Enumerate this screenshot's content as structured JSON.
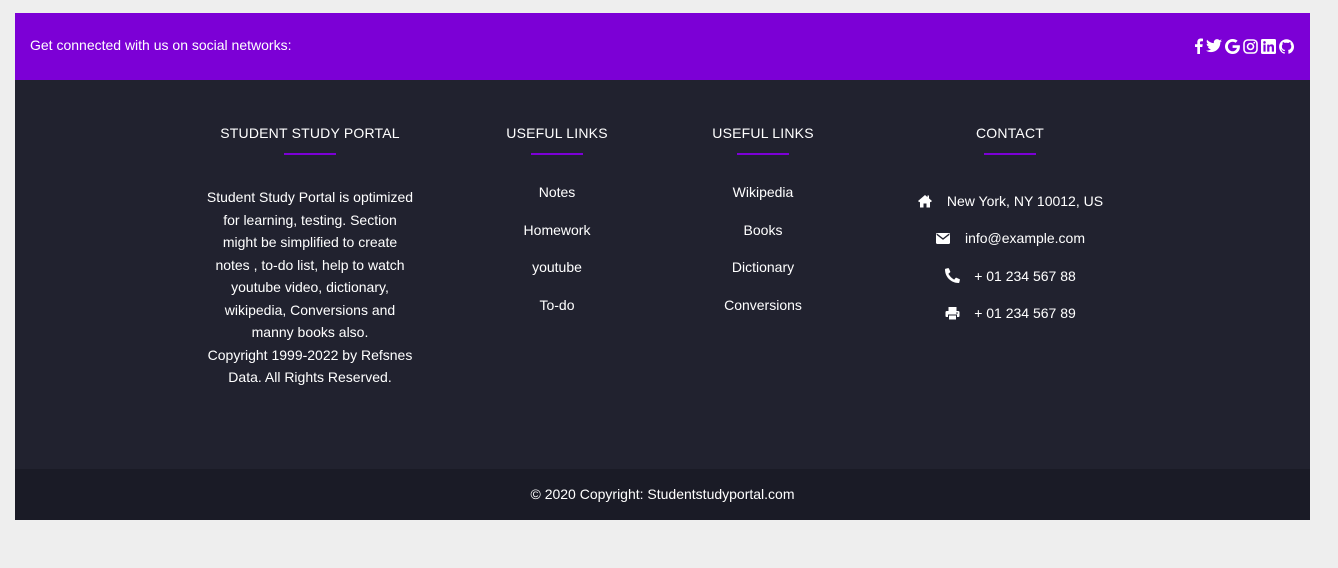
{
  "social": {
    "text": "Get connected with us on social networks:",
    "icons": [
      "facebook-icon",
      "twitter-icon",
      "google-icon",
      "instagram-icon",
      "linkedin-icon",
      "github-icon"
    ]
  },
  "columns": {
    "about": {
      "title": "STUDENT STUDY PORTAL",
      "lines": [
        "Student Study Portal is optimized",
        "for learning, testing. Section",
        "might be simplified to create",
        "notes , to-do list, help to watch",
        "youtube video, dictionary,",
        "wikipedia, Conversions and",
        "manny books also.",
        "Copyright 1999-2022 by Refsnes",
        "Data. All Rights Reserved."
      ]
    },
    "links1": {
      "title": "USEFUL LINKS",
      "items": [
        "Notes",
        "Homework",
        "youtube",
        "To-do"
      ]
    },
    "links2": {
      "title": "USEFUL LINKS",
      "items": [
        "Wikipedia",
        "Books",
        "Dictionary",
        "Conversions"
      ]
    },
    "contact": {
      "title": "CONTACT",
      "items": [
        {
          "icon": "home-icon",
          "text": "New York, NY 10012, US"
        },
        {
          "icon": "envelope-icon",
          "text": "info@example.com"
        },
        {
          "icon": "phone-icon",
          "text": "+ 01 234 567 88"
        },
        {
          "icon": "print-icon",
          "text": "+ 01 234 567 89"
        }
      ]
    }
  },
  "copyright": "© 2020 Copyright: Studentstudyportal.com",
  "colors": {
    "accent": "#7c00d6",
    "footer_bg": "#21222f",
    "copyright_bg": "#1a1b26",
    "page_bg": "#eeeeee"
  }
}
